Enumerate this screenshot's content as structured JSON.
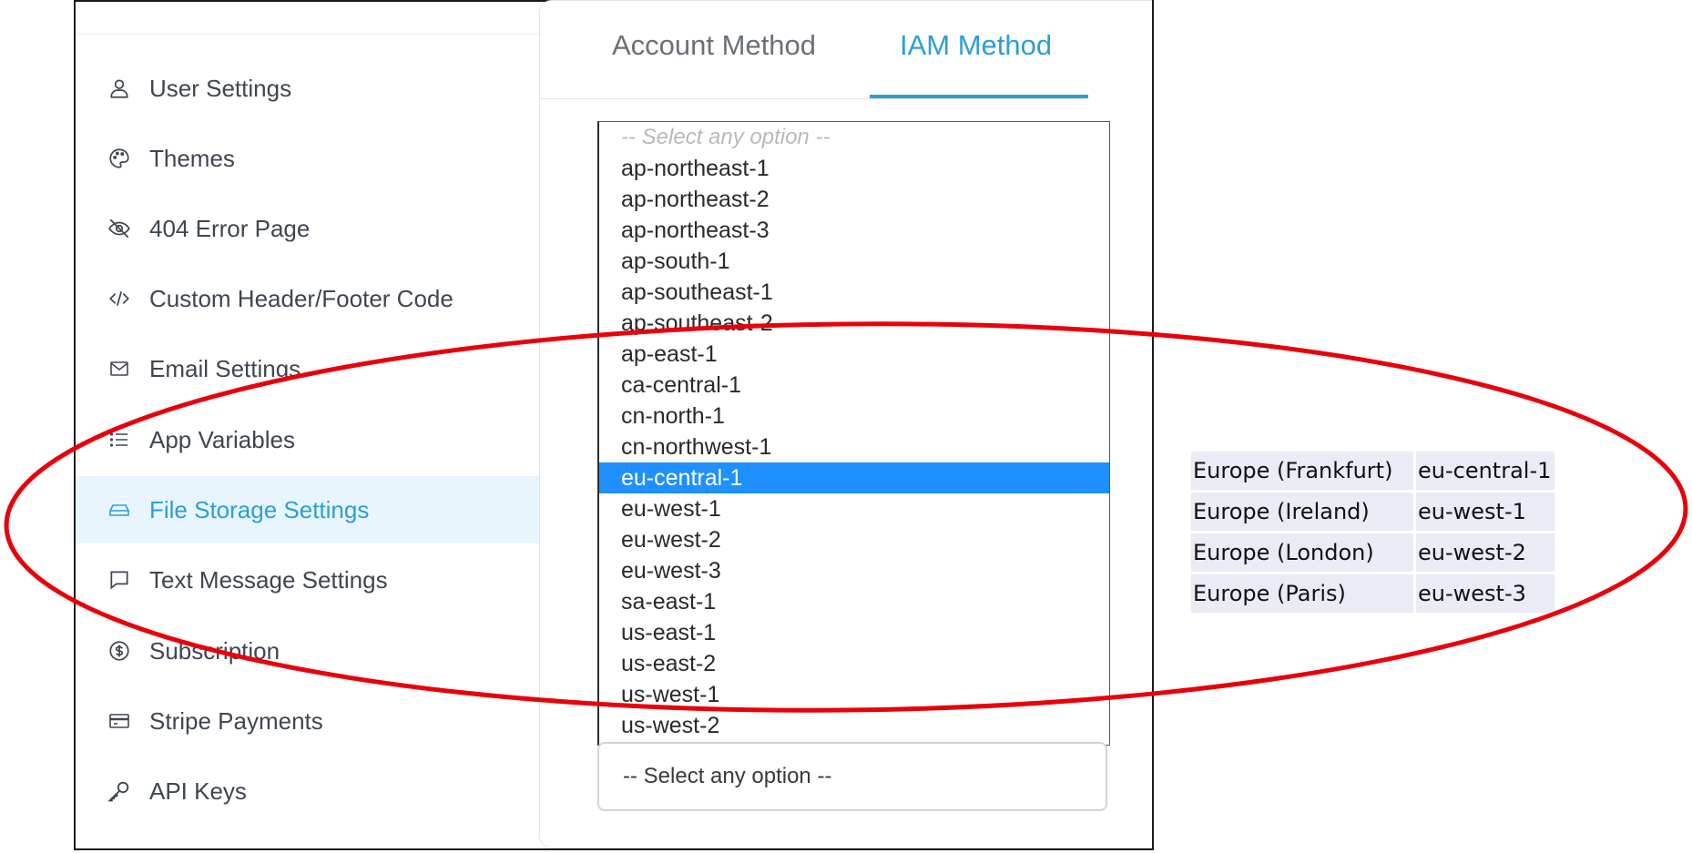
{
  "sidebar": {
    "items": [
      {
        "label": "User Settings",
        "icon": "user-icon"
      },
      {
        "label": "Themes",
        "icon": "palette-icon"
      },
      {
        "label": "404 Error Page",
        "icon": "eye-off-icon"
      },
      {
        "label": "Custom Header/Footer Code",
        "icon": "code-icon"
      },
      {
        "label": "Email Settings",
        "icon": "mail-icon"
      },
      {
        "label": "App Variables",
        "icon": "list-icon"
      },
      {
        "label": "File Storage Settings",
        "icon": "hard-drive-icon",
        "active": true
      },
      {
        "label": "Text Message Settings",
        "icon": "message-icon"
      },
      {
        "label": "Subscription",
        "icon": "dollar-circle-icon"
      },
      {
        "label": "Stripe Payments",
        "icon": "credit-card-icon"
      },
      {
        "label": "API Keys",
        "icon": "key-icon"
      }
    ]
  },
  "tabs": [
    {
      "label": "Account Method",
      "active": false
    },
    {
      "label": "IAM Method",
      "active": true
    }
  ],
  "region_select": {
    "placeholder": "-- Select any option --",
    "options": [
      "ap-northeast-1",
      "ap-northeast-2",
      "ap-northeast-3",
      "ap-south-1",
      "ap-southeast-1",
      "ap-southeast-2",
      "ap-east-1",
      "ca-central-1",
      "cn-north-1",
      "cn-northwest-1",
      "eu-central-1",
      "eu-west-1",
      "eu-west-2",
      "eu-west-3",
      "sa-east-1",
      "us-east-1",
      "us-east-2",
      "us-west-1",
      "us-west-2"
    ],
    "highlighted": "eu-central-1"
  },
  "second_select": {
    "value": "-- Select any option --"
  },
  "region_table": [
    {
      "name": "Europe (Frankfurt)",
      "code": "eu-central-1"
    },
    {
      "name": "Europe (Ireland)",
      "code": "eu-west-1"
    },
    {
      "name": "Europe (London)",
      "code": "eu-west-2"
    },
    {
      "name": "Europe (Paris)",
      "code": "eu-west-3"
    }
  ],
  "colors": {
    "accent": "#2a9fd6",
    "highlight": "#1e90ff",
    "annotation": "#e8000b",
    "active_bg": "#e8f5fc"
  }
}
